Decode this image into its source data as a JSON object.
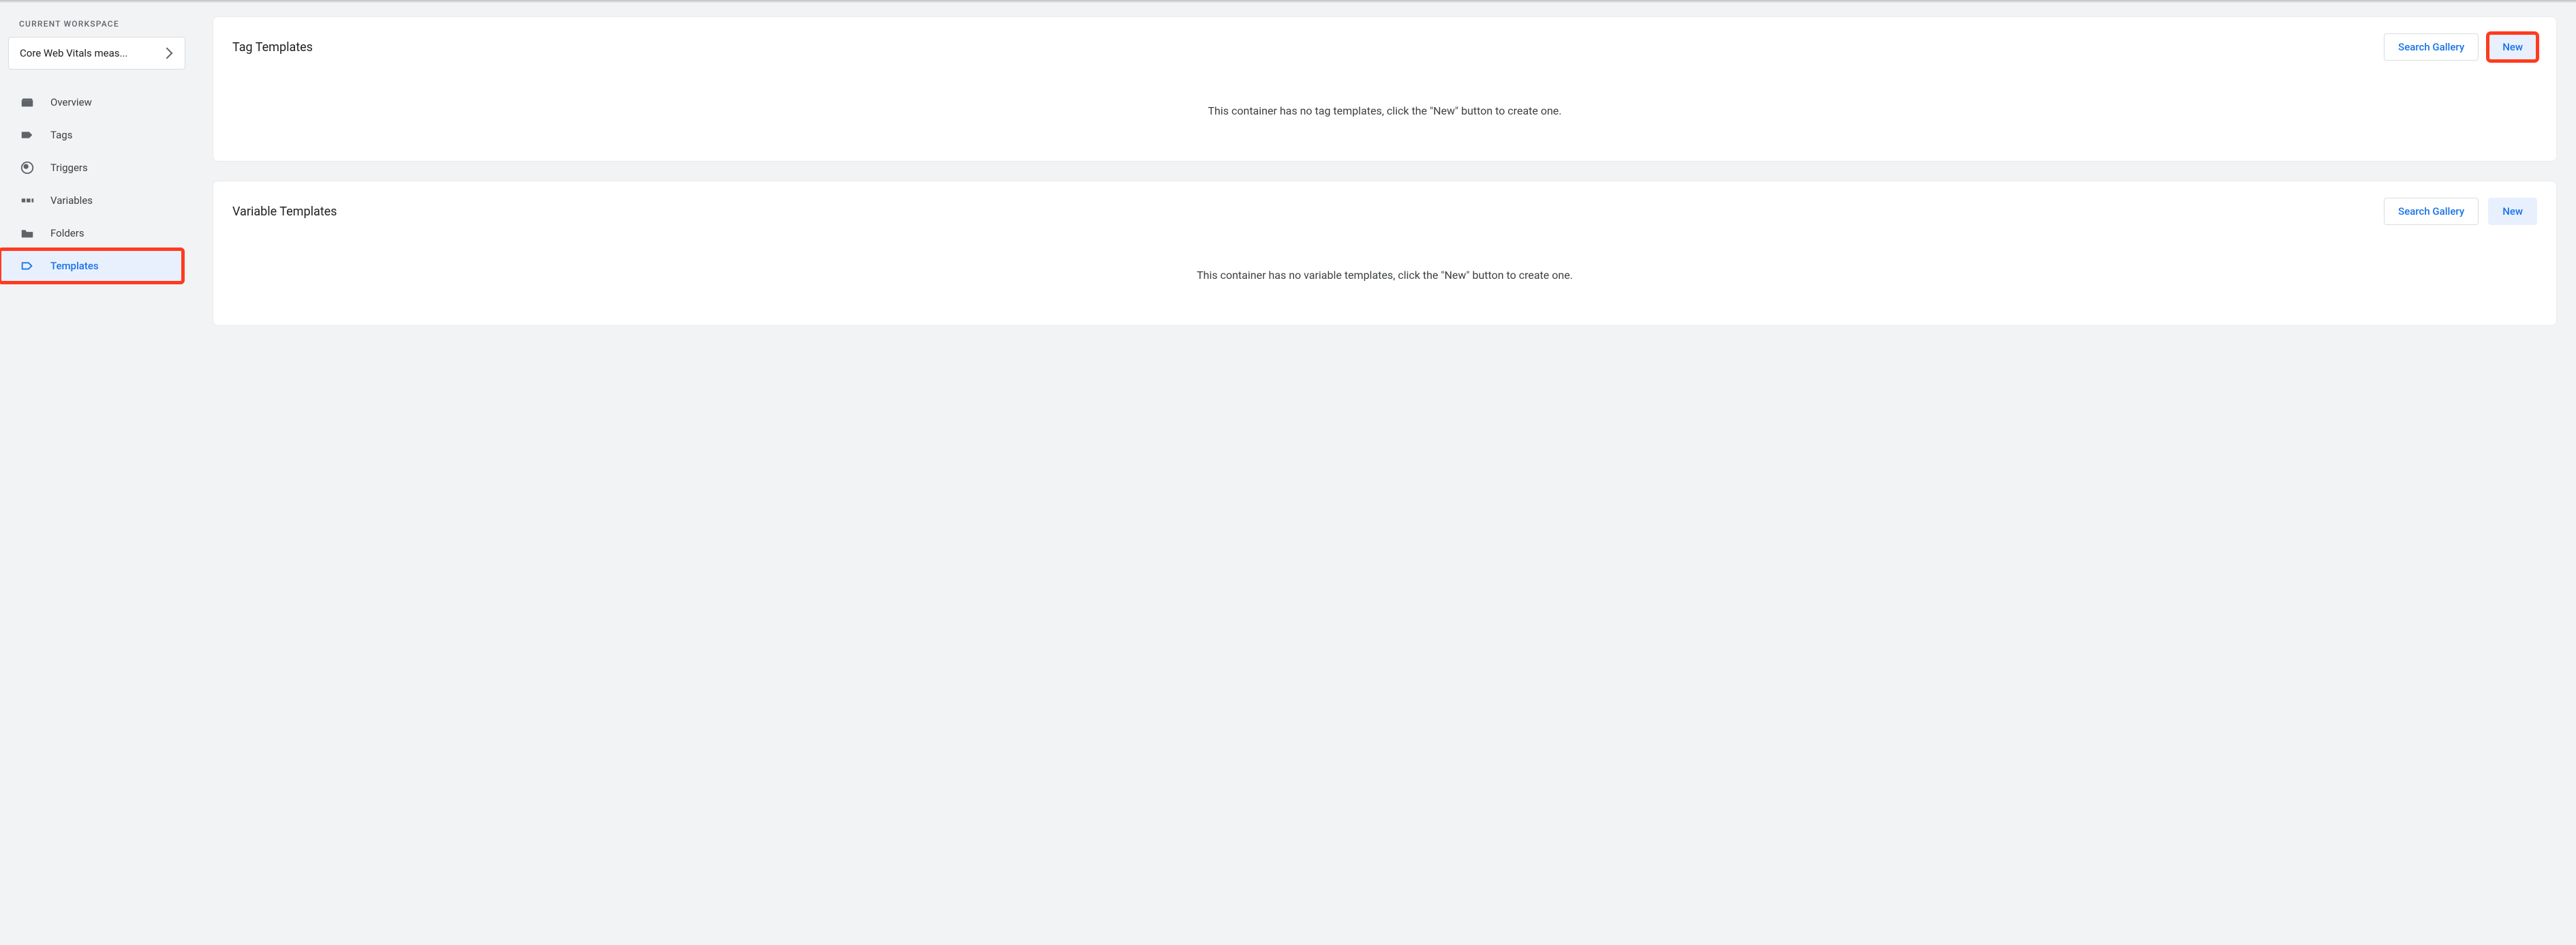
{
  "sidebar": {
    "workspace_heading": "CURRENT WORKSPACE",
    "workspace_name": "Core Web Vitals meas...",
    "items": [
      {
        "label": "Overview"
      },
      {
        "label": "Tags"
      },
      {
        "label": "Triggers"
      },
      {
        "label": "Variables"
      },
      {
        "label": "Folders"
      },
      {
        "label": "Templates"
      }
    ]
  },
  "tag_templates": {
    "title": "Tag Templates",
    "search_gallery_label": "Search Gallery",
    "new_label": "New",
    "empty_message": "This container has no tag templates, click the \"New\" button to create one."
  },
  "variable_templates": {
    "title": "Variable Templates",
    "search_gallery_label": "Search Gallery",
    "new_label": "New",
    "empty_message": "This container has no variable templates, click the \"New\" button to create one."
  }
}
